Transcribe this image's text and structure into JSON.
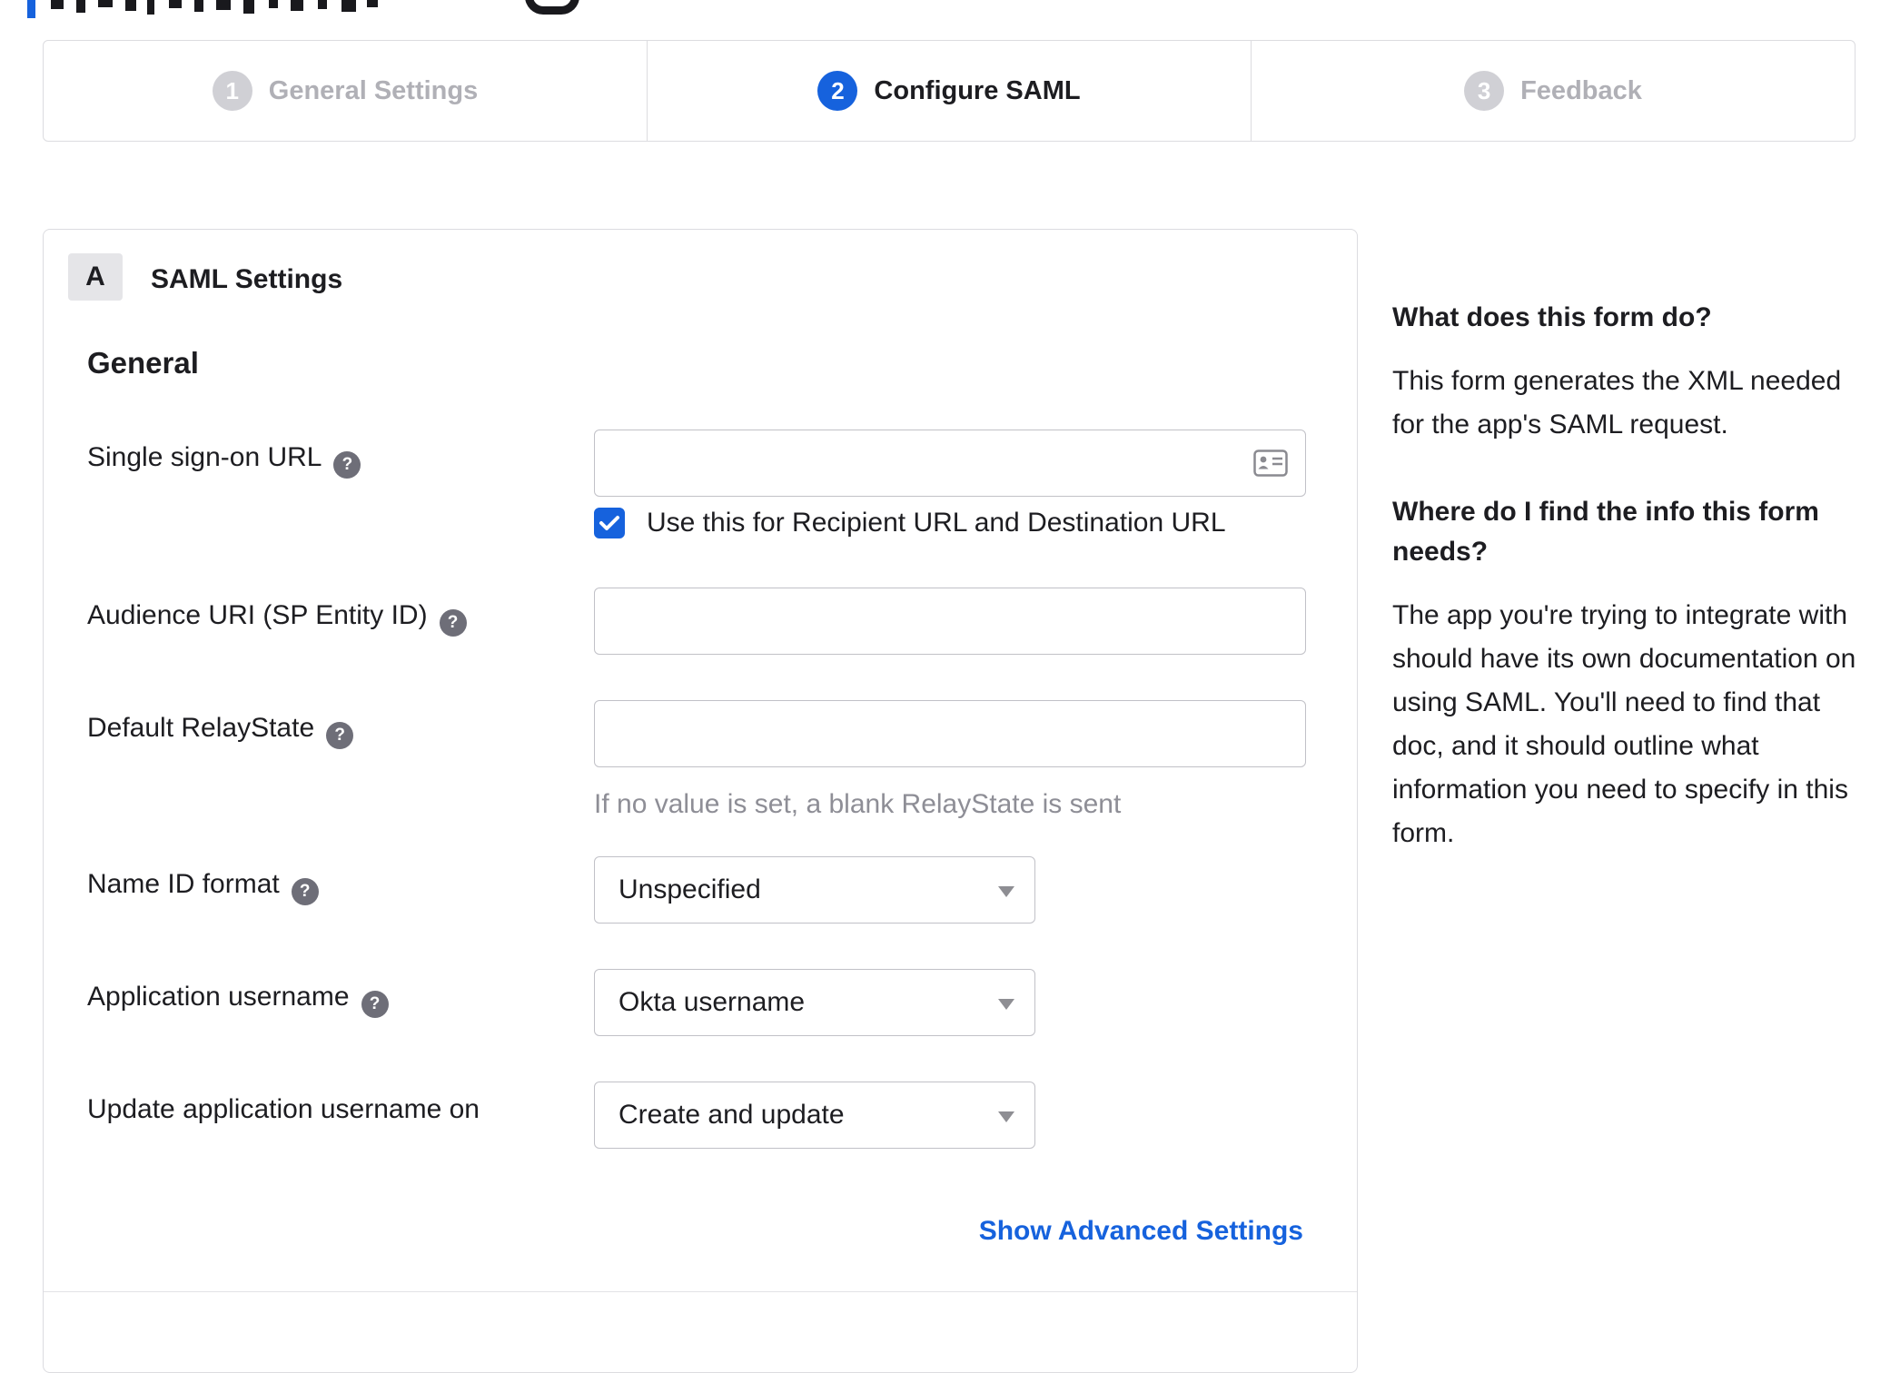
{
  "accent": {
    "brand_blue": "#1662dd",
    "dark_text": "#1d1d21",
    "inactive_gray": "#b0b0b6"
  },
  "stepper": {
    "steps": [
      {
        "number": "1",
        "label": "General Settings",
        "state": "inactive"
      },
      {
        "number": "2",
        "label": "Configure SAML",
        "state": "active"
      },
      {
        "number": "3",
        "label": "Feedback",
        "state": "inactive"
      }
    ]
  },
  "form": {
    "section_badge": "A",
    "section_title": "SAML Settings",
    "group_title": "General",
    "fields": {
      "sso_url": {
        "label": "Single sign-on URL",
        "value": ""
      },
      "sso_checkbox": {
        "label": "Use this for Recipient URL and Destination URL",
        "checked": true
      },
      "audience_uri": {
        "label": "Audience URI (SP Entity ID)",
        "value": ""
      },
      "relay_state": {
        "label": "Default RelayState",
        "value": "",
        "hint": "If no value is set, a blank RelayState is sent"
      },
      "name_id_format": {
        "label": "Name ID format",
        "value": "Unspecified"
      },
      "app_username": {
        "label": "Application username",
        "value": "Okta username"
      },
      "update_app_username": {
        "label": "Update application username on",
        "value": "Create and update"
      }
    },
    "help_icon_glyph": "?",
    "advanced_link": "Show Advanced Settings"
  },
  "sidebar": {
    "sections": [
      {
        "heading": "What does this form do?",
        "body": "This form generates the XML needed for the app's SAML request."
      },
      {
        "heading": "Where do I find the info this form needs?",
        "body": "The app you're trying to integrate with should have its own documentation on using SAML. You'll need to find that doc, and it should outline what information you need to specify in this form."
      }
    ]
  }
}
